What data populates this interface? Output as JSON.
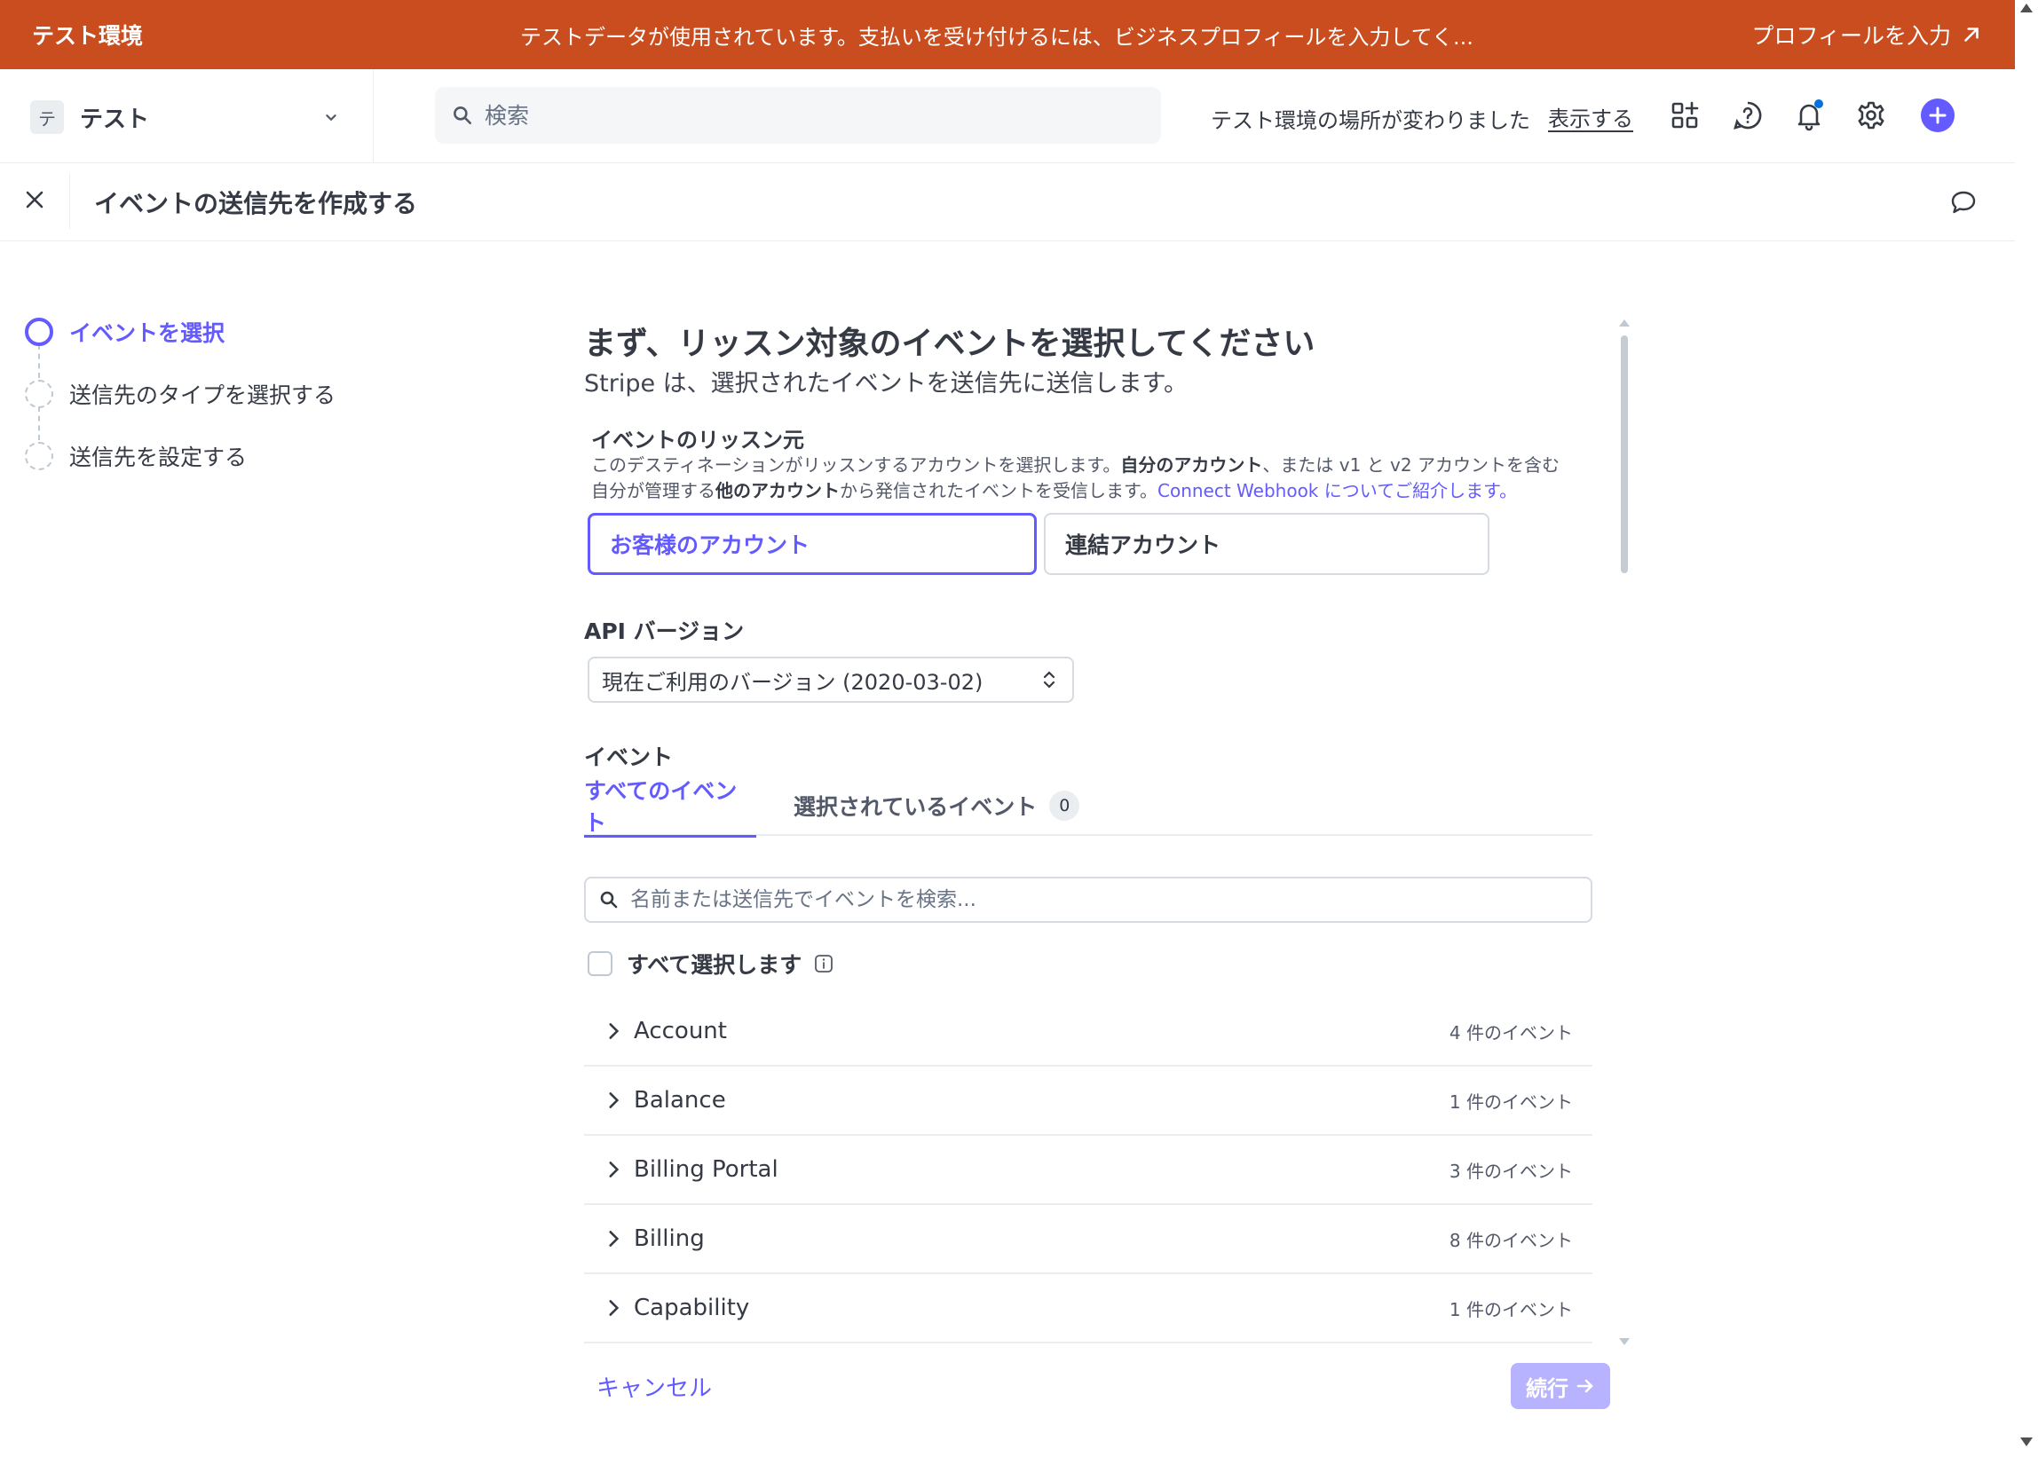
{
  "banner": {
    "title": "テスト環境",
    "message": "テストデータが使用されています。支払いを受け付けるには、ビジネスプロフィールを入力してく...",
    "link_label": "プロフィールを入力"
  },
  "header": {
    "account_initial": "テ",
    "account_name": "テスト",
    "search_placeholder": "検索",
    "notice": "テスト環境の場所が変わりました",
    "notice_link": "表示する",
    "icons": [
      "apps-icon",
      "help-icon",
      "bell-icon",
      "gear-icon",
      "plus-icon"
    ]
  },
  "page": {
    "title": "イベントの送信先を作成する"
  },
  "steps": [
    {
      "label": "イベントを選択",
      "state": "active"
    },
    {
      "label": "送信先のタイプを選択する",
      "state": "pending"
    },
    {
      "label": "送信先を設定する",
      "state": "pending"
    }
  ],
  "main": {
    "heading": "まず、リッスン対象のイベントを選択してください",
    "subheading": "Stripe は、選択されたイベントを送信先に送信します。",
    "source_title": "イベントのリッスン元",
    "desc": {
      "p1": "このデスティネーションがリッスンするアカウントを選択します。",
      "b1": "自分のアカウント",
      "p2": "、または v1 と v2 アカウントを含む",
      "p3": "自分が管理する",
      "b2": "他のアカウント",
      "p4": "から発信されたイベントを受信します。",
      "link": "Connect Webhook についてご紹介します。"
    },
    "source_options": [
      "お客様のアカウント",
      "連結アカウント"
    ],
    "selected_source": "お客様のアカウント",
    "api_label": "API バージョン",
    "api_value": "現在ご利用のバージョン (2020-03-02)",
    "events_label": "イベント",
    "tabs": [
      {
        "label": "すべてのイベント",
        "active": true
      },
      {
        "label": "選択されているイベント",
        "badge": "0",
        "active": false
      }
    ],
    "event_search_placeholder": "名前または送信先でイベントを検索...",
    "select_all_label": "すべて選択します",
    "event_groups": [
      {
        "name": "Account",
        "count": "4 件のイベント"
      },
      {
        "name": "Balance",
        "count": "1 件のイベント"
      },
      {
        "name": "Billing Portal",
        "count": "3 件のイベント"
      },
      {
        "name": "Billing",
        "count": "8 件のイベント"
      },
      {
        "name": "Capability",
        "count": "1 件のイベント"
      }
    ]
  },
  "footer": {
    "cancel_label": "キャンセル",
    "continue_label": "続行"
  },
  "colors": {
    "banner": "#c94d1e",
    "accent": "#635bff",
    "accent_disabled": "#b7b3fe",
    "notification_dot": "#0570de"
  }
}
